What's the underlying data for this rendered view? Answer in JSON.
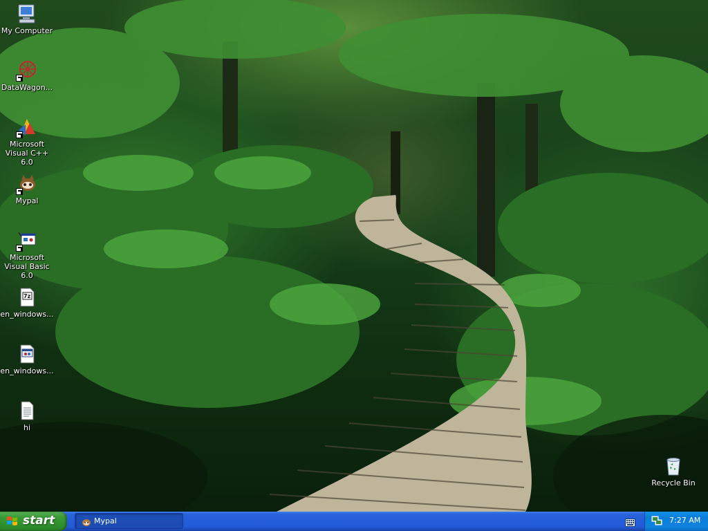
{
  "desktop": {
    "icons": [
      {
        "label": "My Computer"
      },
      {
        "label": "DataWagon..."
      },
      {
        "label": "Microsoft Visual C++ 6.0"
      },
      {
        "label": "Mypal"
      },
      {
        "label": "Microsoft Visual Basic 6.0"
      },
      {
        "label": "en_windows..."
      },
      {
        "label": "en_windows..."
      },
      {
        "label": "hi"
      },
      {
        "label": "Recycle Bin"
      }
    ]
  },
  "taskbar": {
    "start_label": "start",
    "tasks": [
      {
        "label": "Mypal",
        "icon": "mypal-icon"
      }
    ],
    "tray": {
      "clock": "7:27 AM"
    }
  },
  "colors": {
    "taskbar_blue": "#245edb",
    "start_green": "#3c9c3a",
    "tray_blue": "#0f83df"
  }
}
